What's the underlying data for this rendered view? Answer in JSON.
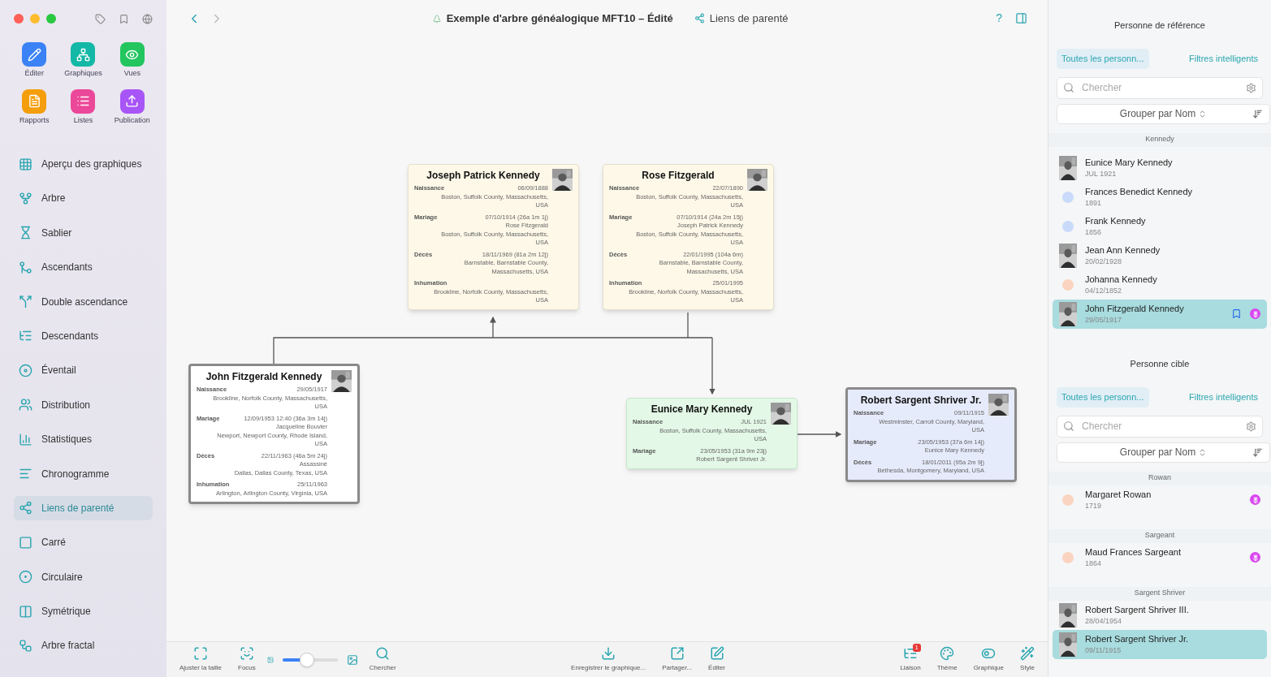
{
  "sidebar": {
    "tools": [
      {
        "label": "Éditer",
        "color": "#3b82f6",
        "kind": "edit"
      },
      {
        "label": "Graphiques",
        "color": "#14b8a6",
        "kind": "charts"
      },
      {
        "label": "Vues",
        "color": "#22c55e",
        "kind": "views"
      },
      {
        "label": "Rapports",
        "color": "#f59e0b",
        "kind": "reports"
      },
      {
        "label": "Listes",
        "color": "#ec4899",
        "kind": "lists"
      },
      {
        "label": "Publication",
        "color": "#a855f7",
        "kind": "publish"
      }
    ],
    "items": [
      {
        "label": "Aperçu des graphiques",
        "kind": "grid",
        "selected": false
      },
      {
        "label": "Arbre",
        "kind": "tree",
        "selected": false
      },
      {
        "label": "Sablier",
        "kind": "hourglass",
        "selected": false
      },
      {
        "label": "Ascendants",
        "kind": "ancestors",
        "selected": false
      },
      {
        "label": "Double ascendance",
        "kind": "double",
        "selected": false
      },
      {
        "label": "Descendants",
        "kind": "descendants",
        "selected": false
      },
      {
        "label": "Éventail",
        "kind": "fan",
        "selected": false
      },
      {
        "label": "Distribution",
        "kind": "distribution",
        "selected": false
      },
      {
        "label": "Statistiques",
        "kind": "stats",
        "selected": false
      },
      {
        "label": "Chronogramme",
        "kind": "timeline",
        "selected": false
      },
      {
        "label": "Liens de parenté",
        "kind": "relations",
        "selected": true
      },
      {
        "label": "Carré",
        "kind": "square",
        "selected": false
      },
      {
        "label": "Circulaire",
        "kind": "circular",
        "selected": false
      },
      {
        "label": "Symétrique",
        "kind": "symmetric",
        "selected": false
      },
      {
        "label": "Arbre fractal",
        "kind": "fractal",
        "selected": false
      }
    ]
  },
  "header": {
    "title": "Exemple d'arbre généalogique MFT10 – Édité",
    "view": "Liens de parenté",
    "help": "?"
  },
  "chart": {
    "cards": [
      {
        "name": "Joseph Patrick Kennedy",
        "kind": "ancestor",
        "events": [
          {
            "label": "Naissance",
            "date": "06/09/1888",
            "lines": [
              "Boston, Suffolk County, Massachusetts,",
              "USA"
            ]
          },
          {
            "label": "Mariage",
            "date": "07/10/1914 (26a 1m 1j)",
            "lines": [
              "Rose Fitzgerald",
              "Boston, Suffolk County, Massachusetts,",
              "USA"
            ]
          },
          {
            "label": "Décès",
            "date": "18/11/1969 (81a 2m 12j)",
            "lines": [
              "Barnstable, Barnstable County,",
              "Massachusetts, USA"
            ]
          },
          {
            "label": "Inhumation",
            "lines": [
              "Brookline, Norfolk County, Massachusetts,",
              "USA"
            ]
          }
        ]
      },
      {
        "name": "Rose Fitzgerald",
        "kind": "ancestor",
        "events": [
          {
            "label": "Naissance",
            "date": "22/07/1890",
            "lines": [
              "Boston, Suffolk County, Massachusetts,",
              "USA"
            ]
          },
          {
            "label": "Mariage",
            "date": "07/10/1914 (24a 2m 15j)",
            "lines": [
              "Joseph Patrick Kennedy",
              "Boston, Suffolk County, Massachusetts,",
              "USA"
            ]
          },
          {
            "label": "Décès",
            "date": "22/01/1995 (104a 6m)",
            "lines": [
              "Barnstable, Barnstable County,",
              "Massachusetts, USA"
            ]
          },
          {
            "label": "Inhumation",
            "date": "25/01/1995",
            "lines": [
              "Brookline, Norfolk County, Massachusetts,",
              "USA"
            ]
          }
        ]
      },
      {
        "name": "John Fitzgerald Kennedy",
        "kind": "reference",
        "events": [
          {
            "label": "Naissance",
            "date": "29/05/1917",
            "lines": [
              "Brookline, Norfolk County, Massachusetts,",
              "USA"
            ]
          },
          {
            "label": "Mariage",
            "date": "12/09/1953 12:40 (36a 3m 14j)",
            "lines": [
              "Jacqueline Bouvier",
              "Newport, Newport County, Rhode Island,",
              "USA"
            ]
          },
          {
            "label": "Décès",
            "date": "22/11/1963 (46a 5m 24j)",
            "lines": [
              "Assassiné",
              "Dallas, Dallas County, Texas, USA"
            ]
          },
          {
            "label": "Inhumation",
            "date": "25/11/1963",
            "lines": [
              "Arlington, Arlington County, Virginia, USA"
            ]
          }
        ]
      },
      {
        "name": "Eunice Mary Kennedy",
        "kind": "path",
        "events": [
          {
            "label": "Naissance",
            "date": "JUL 1921",
            "lines": [
              "Boston, Suffolk County, Massachusetts,",
              "USA"
            ]
          },
          {
            "label": "Mariage",
            "date": "23/05/1953 (31a 9m 23j)",
            "lines": [
              "Robert Sargent Shriver Jr."
            ]
          }
        ]
      },
      {
        "name": "Robert Sargent Shriver Jr.",
        "kind": "target",
        "events": [
          {
            "label": "Naissance",
            "date": "09/11/1915",
            "lines": [
              "Westminster, Carroll County, Maryland,",
              "USA"
            ]
          },
          {
            "label": "Mariage",
            "date": "23/05/1953 (37a 6m 14j)",
            "lines": [
              "Eunice Mary Kennedy"
            ]
          },
          {
            "label": "Décès",
            "date": "18/01/2011 (95a 2m 9j)",
            "lines": [
              "Bethesda, Montgomery, Maryland, USA"
            ]
          }
        ]
      }
    ]
  },
  "panels": [
    {
      "title": "Personne de référence",
      "tabs": [
        {
          "label": "Toutes les personn...",
          "selected": true
        },
        {
          "label": "Filtres intelligents",
          "selected": false
        }
      ],
      "search": {
        "placeholder": "Chercher"
      },
      "group_by": "Grouper par Nom",
      "groups": [
        {
          "name": "Kennedy",
          "people": [
            {
              "name": "Eunice Mary Kennedy",
              "date": "JUL 1921",
              "selected": false,
              "bookmark": false,
              "badge": false
            },
            {
              "name": "Frances Benedict Kennedy",
              "date": "1891",
              "kind": "dot",
              "color": "#c9dafa",
              "selected": false,
              "bookmark": false,
              "badge": false
            },
            {
              "name": "Frank Kennedy",
              "date": "1856",
              "kind": "dot",
              "color": "#c9dafa",
              "selected": false,
              "bookmark": false,
              "badge": false
            },
            {
              "name": "Jean Ann Kennedy",
              "date": "20/02/1928",
              "selected": false,
              "bookmark": false,
              "badge": false
            },
            {
              "name": "Johanna Kennedy",
              "date": "04/12/1852",
              "kind": "dot",
              "color": "#fad4c0",
              "selected": false,
              "bookmark": false,
              "badge": false
            },
            {
              "name": "John Fitzgerald Kennedy",
              "date": "29/05/1917",
              "selected": true,
              "bookmark": true,
              "badge": true
            }
          ]
        }
      ]
    },
    {
      "title": "Personne cible",
      "tabs": [
        {
          "label": "Toutes les personn...",
          "selected": true
        },
        {
          "label": "Filtres intelligents",
          "selected": false
        }
      ],
      "search": {
        "placeholder": "Chercher"
      },
      "group_by": "Grouper par Nom",
      "groups": [
        {
          "name": "Rowan",
          "people": [
            {
              "name": "Margaret Rowan",
              "date": "1719",
              "kind": "dot",
              "color": "#fad4c0",
              "selected": false,
              "bookmark": false,
              "badge": true
            }
          ]
        },
        {
          "name": "Sargeant",
          "people": [
            {
              "name": "Maud Frances Sargeant",
              "date": "1864",
              "kind": "dot",
              "color": "#fad4c0",
              "selected": false,
              "bookmark": false,
              "badge": true
            }
          ]
        },
        {
          "name": "Sargent Shriver",
          "people": [
            {
              "name": "Robert Sargent Shriver III.",
              "date": "28/04/1954",
              "selected": false,
              "bookmark": false,
              "badge": false
            },
            {
              "name": "Robert Sargent Shriver Jr.",
              "date": "09/11/1915",
              "selected": true,
              "bookmark": false,
              "badge": false
            }
          ]
        }
      ]
    }
  ],
  "toolbar": {
    "left": [
      {
        "label": "Ajuster la taille",
        "kind": "fit"
      },
      {
        "label": "Focus",
        "kind": "focus"
      }
    ],
    "zoom": {
      "level": 0.45
    },
    "search": {
      "label": "Chercher",
      "kind": "search"
    },
    "center": [
      {
        "label": "Enregistrer le graphique...",
        "kind": "save"
      },
      {
        "label": "Partager...",
        "kind": "share"
      },
      {
        "label": "Éditer",
        "kind": "edit"
      }
    ],
    "right": [
      {
        "label": "Liaison",
        "kind": "link",
        "badge": "1"
      },
      {
        "label": "Thème",
        "kind": "theme"
      },
      {
        "label": "Graphique",
        "kind": "chart"
      },
      {
        "label": "Style",
        "kind": "style"
      }
    ]
  }
}
